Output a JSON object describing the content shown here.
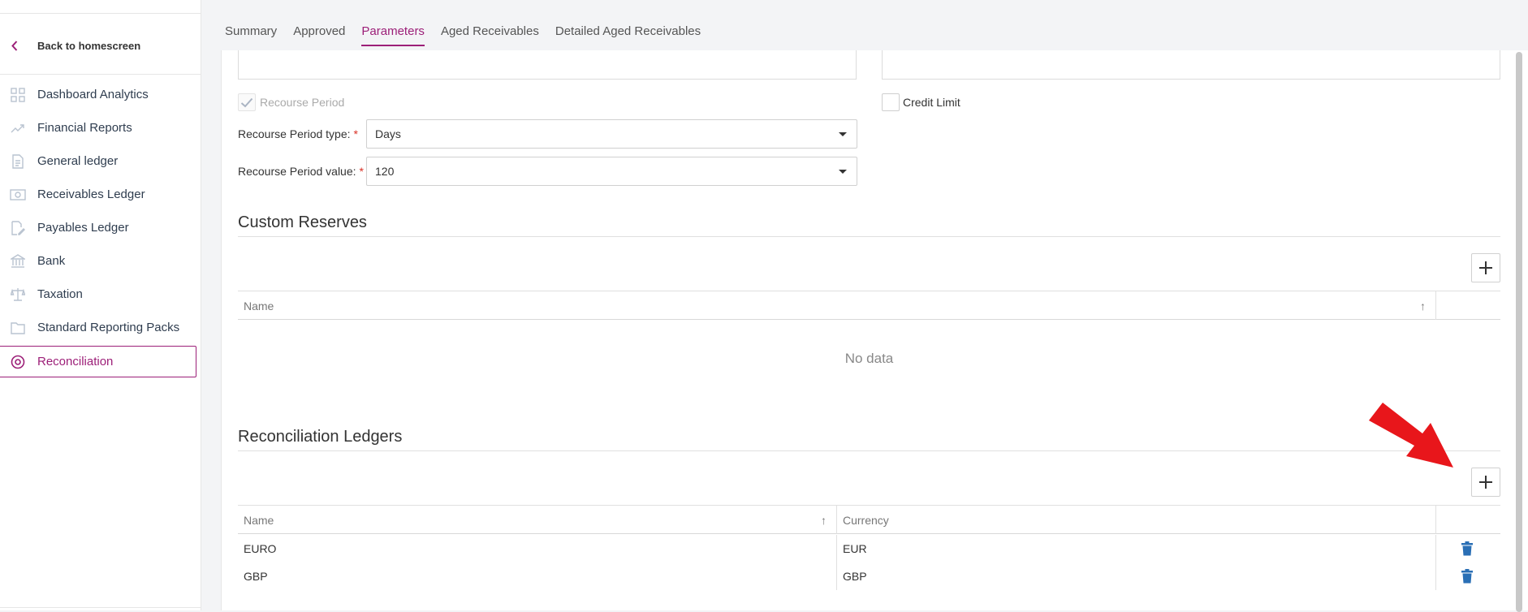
{
  "sidebar": {
    "back_label": "Back to homescreen",
    "items": [
      {
        "label": "Dashboard Analytics",
        "icon": "grid-icon"
      },
      {
        "label": "Financial Reports",
        "icon": "trend-icon"
      },
      {
        "label": "General ledger",
        "icon": "document-icon"
      },
      {
        "label": "Receivables Ledger",
        "icon": "banknote-icon"
      },
      {
        "label": "Payables Ledger",
        "icon": "edit-document-icon"
      },
      {
        "label": "Bank",
        "icon": "bank-icon"
      },
      {
        "label": "Taxation",
        "icon": "scales-icon"
      },
      {
        "label": "Standard Reporting Packs",
        "icon": "folder-icon"
      },
      {
        "label": "Reconciliation",
        "icon": "target-icon",
        "active": true
      }
    ]
  },
  "tabs": [
    "Summary",
    "Approved",
    "Parameters",
    "Aged Receivables",
    "Detailed Aged Receivables"
  ],
  "active_tab": "Parameters",
  "form": {
    "recourse_period_label": "Recourse Period",
    "recourse_period_checked": true,
    "credit_limit_label": "Credit Limit",
    "credit_limit_checked": false,
    "recourse_type_label": "Recourse Period type:",
    "recourse_type_value": "Days",
    "recourse_value_label": "Recourse Period value:",
    "recourse_value_value": "120",
    "required_mark": "*"
  },
  "custom_reserves": {
    "title": "Custom Reserves",
    "columns": [
      "Name"
    ],
    "sort_icon": "↑",
    "empty_text": "No data"
  },
  "reconciliation_ledgers": {
    "title": "Reconciliation Ledgers",
    "columns": [
      "Name",
      "Currency"
    ],
    "sort_icon": "↑",
    "rows": [
      {
        "name": "EURO",
        "currency": "EUR"
      },
      {
        "name": "GBP",
        "currency": "GBP"
      }
    ]
  },
  "colors": {
    "accent": "#9c1f78",
    "trash": "#2a6fb5",
    "annotation_arrow": "#e8161b"
  }
}
